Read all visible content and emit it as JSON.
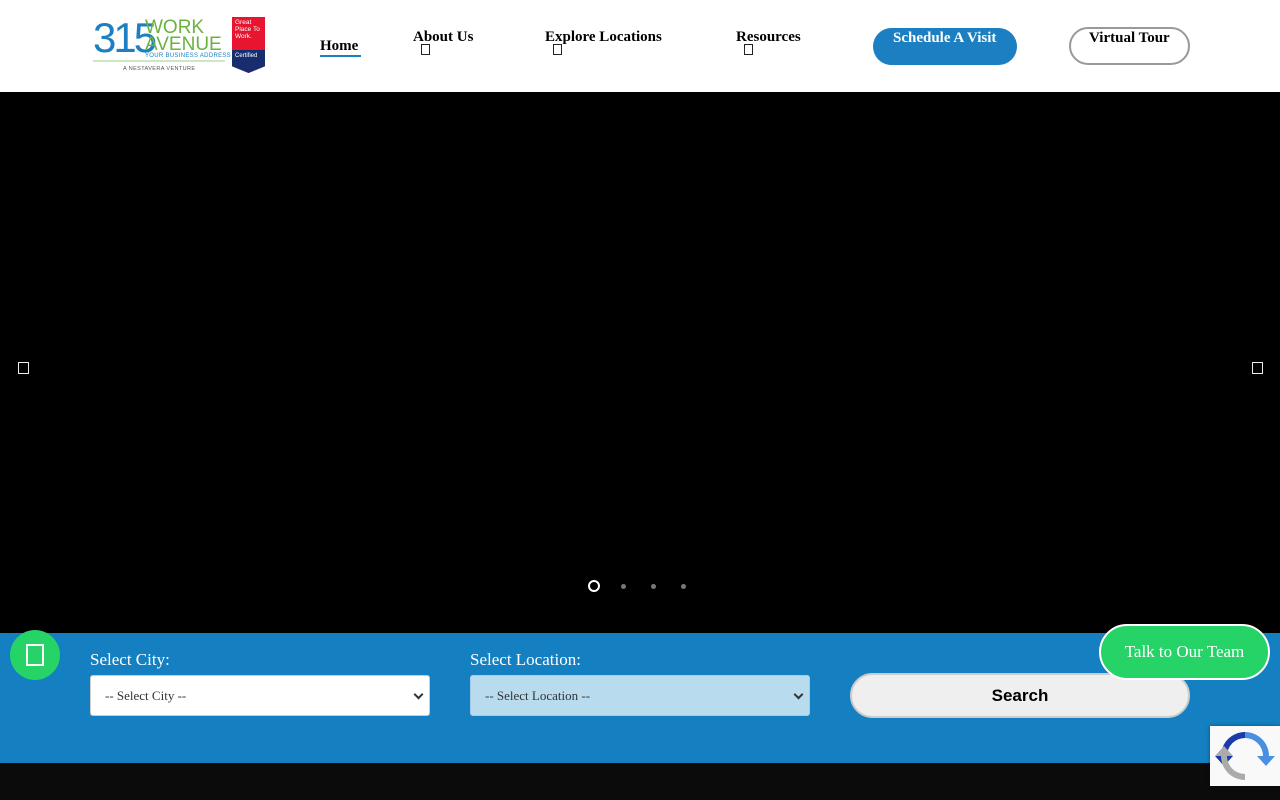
{
  "brand": {
    "logo_number": "315",
    "logo_word1": "WORK",
    "logo_word2": "AVENUE",
    "tagline": "YOUR BUSINESS ADDRESS",
    "venture": "A NESTAVERA VENTURE",
    "badge_text": "Great Place To Work.",
    "badge_certified": "Certified",
    "colors": {
      "primary": "#1b7fc1",
      "green": "#6bb23f",
      "badge_red": "#e7152f",
      "badge_navy": "#182d6e"
    }
  },
  "nav": {
    "home": "Home",
    "about": "About Us",
    "explore": "Explore Locations",
    "resources": "Resources",
    "caret_icon": "chevron-down-icon",
    "schedule": "Schedule A Visit",
    "virtual_tour": "Virtual Tour"
  },
  "hero": {
    "prev_icon": "chevron-left-icon",
    "next_icon": "chevron-right-icon",
    "slide_count": 4,
    "active_slide": 1
  },
  "search": {
    "city_label": "Select City:",
    "city_value": "-- Select City --",
    "location_label": "Select Location:",
    "location_value": "-- Select Location --",
    "search_button": "Search",
    "bar_color": "#1480c1"
  },
  "floating": {
    "whatsapp_icon": "whatsapp-icon",
    "talk_button": "Talk to Our Team",
    "accent": "#25d366"
  }
}
